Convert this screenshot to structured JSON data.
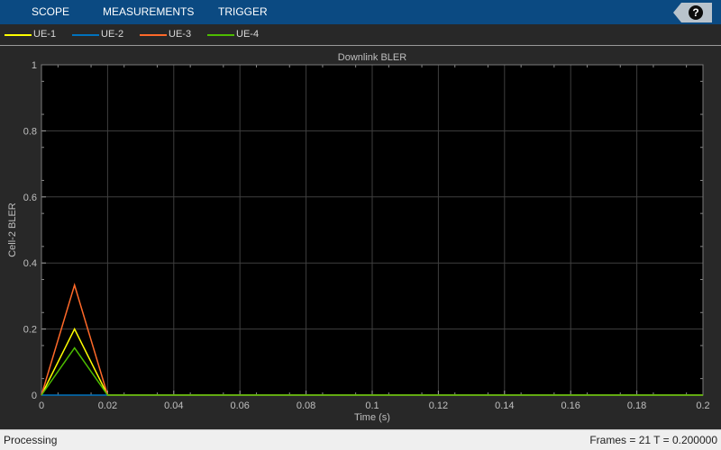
{
  "toolstrip": {
    "tabs": [
      {
        "label": "SCOPE"
      },
      {
        "label": "MEASUREMENTS"
      },
      {
        "label": "TRIGGER"
      }
    ],
    "help_icon": "question-mark-icon",
    "help_glyph": "?"
  },
  "colors": {
    "toolstrip": "#0b4a82",
    "plot_background": "#000000",
    "figure_background": "#282828",
    "grid": "#3f3f3f",
    "axis_text": "#bfbfbf"
  },
  "chart_data": {
    "type": "line",
    "title": "Downlink BLER",
    "xlabel": "Time (s)",
    "ylabel": "Cell-2 BLER",
    "xlim": [
      0,
      0.2
    ],
    "ylim": [
      0,
      1
    ],
    "xticks": [
      "0",
      "0.02",
      "0.04",
      "0.06",
      "0.08",
      "0.1",
      "0.12",
      "0.14",
      "0.16",
      "0.18",
      "0.2"
    ],
    "yticks": [
      "0",
      "0.2",
      "0.4",
      "0.6",
      "0.8",
      "1"
    ],
    "grid": true,
    "legend_position": "top-left",
    "series": [
      {
        "name": "UE-1",
        "color": "#ffff00",
        "x": [
          0,
          0.01,
          0.02,
          0.2
        ],
        "y": [
          0,
          0.2,
          0,
          0
        ]
      },
      {
        "name": "UE-2",
        "color": "#0072bd",
        "x": [
          0,
          0.01,
          0.02,
          0.2
        ],
        "y": [
          0,
          0,
          0,
          0
        ]
      },
      {
        "name": "UE-3",
        "color": "#ff6929",
        "x": [
          0,
          0.01,
          0.02,
          0.2
        ],
        "y": [
          0,
          0.333,
          0,
          0
        ]
      },
      {
        "name": "UE-4",
        "color": "#4dbd00",
        "x": [
          0,
          0.01,
          0.02,
          0.2
        ],
        "y": [
          0,
          0.143,
          0,
          0
        ]
      }
    ]
  },
  "status": {
    "left": "Processing",
    "right": "Frames = 21  T = 0.200000"
  }
}
